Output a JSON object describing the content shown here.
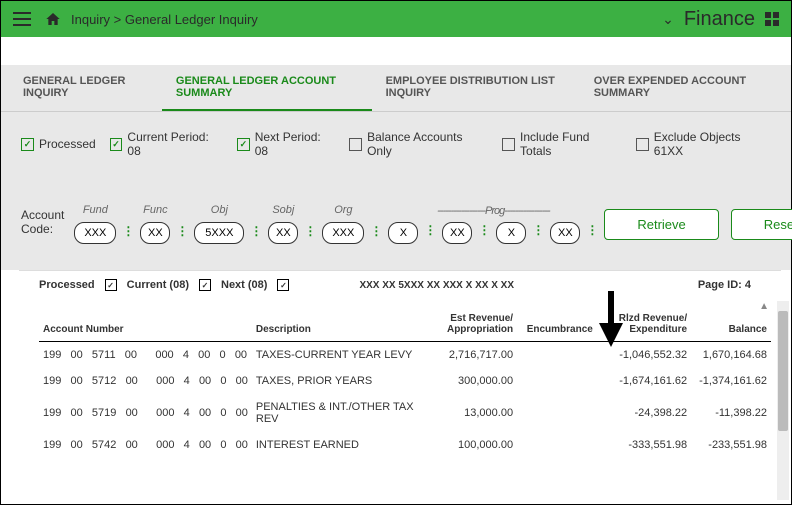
{
  "header": {
    "breadcrumb": "Inquiry > General Ledger Inquiry",
    "module": "Finance"
  },
  "tabs": [
    {
      "label": "GENERAL LEDGER INQUIRY",
      "active": false
    },
    {
      "label": "GENERAL LEDGER ACCOUNT SUMMARY",
      "active": true
    },
    {
      "label": "EMPLOYEE DISTRIBUTION LIST INQUIRY",
      "active": false
    },
    {
      "label": "OVER EXPENDED ACCOUNT SUMMARY",
      "active": false
    }
  ],
  "filters_left": [
    {
      "label": "Processed",
      "checked": true
    },
    {
      "label": "Current Period: 08",
      "checked": true
    },
    {
      "label": "Next Period: 08",
      "checked": true
    }
  ],
  "filters_right": [
    {
      "label": "Balance Accounts Only",
      "checked": false
    },
    {
      "label": "Include Fund Totals",
      "checked": false
    },
    {
      "label": "Exclude Objects 61XX",
      "checked": false
    }
  ],
  "account_code": {
    "label": "Account Code:",
    "headers": [
      "Fund",
      "Func",
      "Obj",
      "Sobj",
      "Org",
      "------------------Prog-----------------"
    ],
    "fields": [
      {
        "value": "XXX",
        "cls": ""
      },
      {
        "value": "XX",
        "cls": "sm"
      },
      {
        "value": "5XXX",
        "cls": "md"
      },
      {
        "value": "XX",
        "cls": "sm"
      },
      {
        "value": "XXX",
        "cls": ""
      },
      {
        "value": "X",
        "cls": "sm"
      },
      {
        "value": "XX",
        "cls": "sm"
      },
      {
        "value": "X",
        "cls": "sm"
      },
      {
        "value": "XX",
        "cls": "sm"
      }
    ]
  },
  "buttons": {
    "retrieve": "Retrieve",
    "reset": "Reset"
  },
  "report": {
    "toprow": {
      "processed": "Processed",
      "current": "Current  (08)",
      "next": "Next  (08)",
      "code": "XXX  XX  5XXX  XX  XXX  X  XX  X  XX",
      "page": "Page ID: 4"
    },
    "columns": [
      "Account Number",
      "Description",
      "Est Revenue/ Appropriation",
      "Encumbrance",
      "Rlzd Revenue/ Expenditure",
      "Balance"
    ],
    "rows": [
      {
        "acct": "199   00   5711   00      000   4   00   0   00",
        "desc": "TAXES-CURRENT YEAR LEVY",
        "est": "2,716,717.00",
        "enc": "",
        "rlzd": "-1,046,552.32",
        "bal": "1,670,164.68"
      },
      {
        "acct": "199   00   5712   00      000   4   00   0   00",
        "desc": "TAXES, PRIOR YEARS",
        "est": "300,000.00",
        "enc": "",
        "rlzd": "-1,674,161.62",
        "bal": "-1,374,161.62"
      },
      {
        "acct": "199   00   5719   00      000   4   00   0   00",
        "desc": "PENALTIES & INT./OTHER TAX REV",
        "est": "13,000.00",
        "enc": "",
        "rlzd": "-24,398.22",
        "bal": "-11,398.22"
      },
      {
        "acct": "199   00   5742   00      000   4   00   0   00",
        "desc": "INTEREST EARNED",
        "est": "100,000.00",
        "enc": "",
        "rlzd": "-333,551.98",
        "bal": "-233,551.98"
      }
    ]
  }
}
